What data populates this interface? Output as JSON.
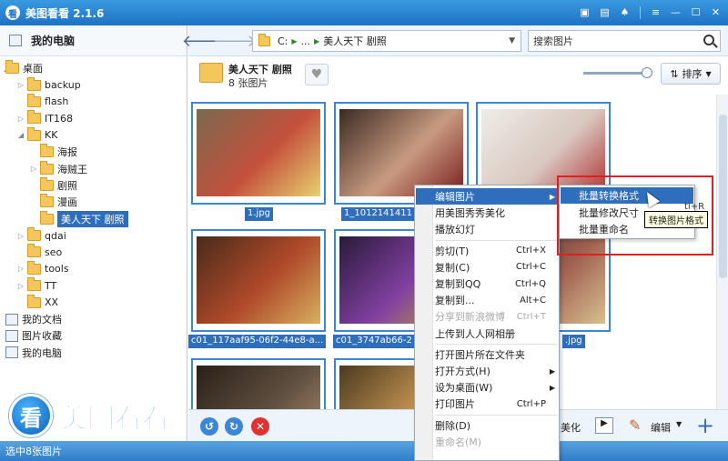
{
  "app": {
    "title": "美图看看 2.1.6",
    "logo_glyph": "看"
  },
  "sidebar": {
    "root_label": "我的电脑",
    "tree": [
      {
        "label": "桌面",
        "level": 0,
        "expanded": true,
        "type": "folder"
      },
      {
        "label": "backup",
        "level": 1,
        "type": "folder",
        "has_children": true
      },
      {
        "label": "flash",
        "level": 1,
        "type": "folder"
      },
      {
        "label": "IT168",
        "level": 1,
        "type": "folder",
        "has_children": true
      },
      {
        "label": "KK",
        "level": 1,
        "type": "folder",
        "expanded": true
      },
      {
        "label": "海报",
        "level": 2,
        "type": "folder"
      },
      {
        "label": "海贼王",
        "level": 2,
        "type": "folder",
        "has_children": true
      },
      {
        "label": "剧照",
        "level": 2,
        "type": "folder"
      },
      {
        "label": "漫画",
        "level": 2,
        "type": "folder"
      },
      {
        "label": "美人天下 剧照",
        "level": 2,
        "type": "folder",
        "selected": true
      },
      {
        "label": "qdai",
        "level": 1,
        "type": "folder",
        "has_children": true
      },
      {
        "label": "seo",
        "level": 1,
        "type": "folder"
      },
      {
        "label": "tools",
        "level": 1,
        "type": "folder",
        "has_children": true
      },
      {
        "label": "TT",
        "level": 1,
        "type": "folder",
        "has_children": true
      },
      {
        "label": "XX",
        "level": 1,
        "type": "folder"
      },
      {
        "label": "我的文档",
        "level": 0,
        "type": "docs"
      },
      {
        "label": "图片收藏",
        "level": 0,
        "type": "favorites"
      },
      {
        "label": "我的电脑",
        "level": 0,
        "type": "computer"
      }
    ]
  },
  "nav": {
    "path": {
      "drive": "C:",
      "ellipsis": "...",
      "folder": "美人天下 剧照"
    },
    "search_placeholder": "搜索图片"
  },
  "folder_info": {
    "name": "美人天下 剧照",
    "count": "8 张图片"
  },
  "sort_label": "排序",
  "thumbnails": [
    {
      "caption": "1.jpg",
      "colors": [
        "#7a6a4e",
        "#c4503c",
        "#e8d070"
      ]
    },
    {
      "caption": "1_1012141411",
      "colors": [
        "#3b2a22",
        "#c89a80",
        "#7a1e1e"
      ]
    },
    {
      "caption": "",
      "colors": [
        "#f0ece8",
        "#d8c8c0",
        "#b03030"
      ]
    },
    {
      "caption": "c01_117aaf95-06f2-44e8-a...",
      "colors": [
        "#4a2a1a",
        "#b04a2a",
        "#d8b060"
      ]
    },
    {
      "caption": "c01_3747ab66-2",
      "colors": [
        "#2a1a3a",
        "#8040a0",
        "#c8a040"
      ]
    },
    {
      "caption": ".jpg",
      "colors": [
        "#3a2a2a",
        "#a06050",
        "#d8c090"
      ]
    },
    {
      "caption": "",
      "colors": [
        "#2a2018",
        "#605040",
        "#b09070"
      ]
    },
    {
      "caption": "",
      "colors": [
        "#4a3a20",
        "#c09050",
        "#e0d0b0"
      ]
    }
  ],
  "context_menu": {
    "items": [
      {
        "label": "编辑图片",
        "submenu": true,
        "highlighted": true
      },
      {
        "label": "用美图秀秀美化"
      },
      {
        "label": "播放幻灯"
      },
      {
        "separator": true
      },
      {
        "label": "剪切(T)",
        "shortcut": "Ctrl+X"
      },
      {
        "label": "复制(C)",
        "shortcut": "Ctrl+C"
      },
      {
        "label": "复制到QQ",
        "shortcut": "Ctrl+Q"
      },
      {
        "label": "复制到...",
        "shortcut": "Alt+C"
      },
      {
        "label": "分享到新浪微博",
        "shortcut": "Ctrl+T",
        "disabled": true
      },
      {
        "label": "上传到人人网相册"
      },
      {
        "separator": true
      },
      {
        "label": "打开图片所在文件夹"
      },
      {
        "label": "打开方式(H)",
        "submenu": true
      },
      {
        "label": "设为桌面(W)",
        "submenu": true
      },
      {
        "label": "打印图片",
        "shortcut": "Ctrl+P"
      },
      {
        "separator": true
      },
      {
        "label": "删除(D)"
      },
      {
        "label": "重命名(M)",
        "disabled": true
      }
    ]
  },
  "submenu": {
    "items": [
      {
        "label": "批量转换格式",
        "highlighted": true
      },
      {
        "label": "批量修改尺寸"
      },
      {
        "label": "批量重命名"
      }
    ]
  },
  "tooltip": "转换图片格式",
  "partial_texts": {
    "behind_tooltip": "tl+R"
  },
  "bottom": {
    "beautify_label": "美化",
    "edit_label": "编辑"
  },
  "logo_text": "美图看看",
  "status": "选中8张图片",
  "colors": {
    "accent": "#2f6ebc",
    "titlebar": "#1d72c4",
    "highlight_box": "#e02020"
  }
}
